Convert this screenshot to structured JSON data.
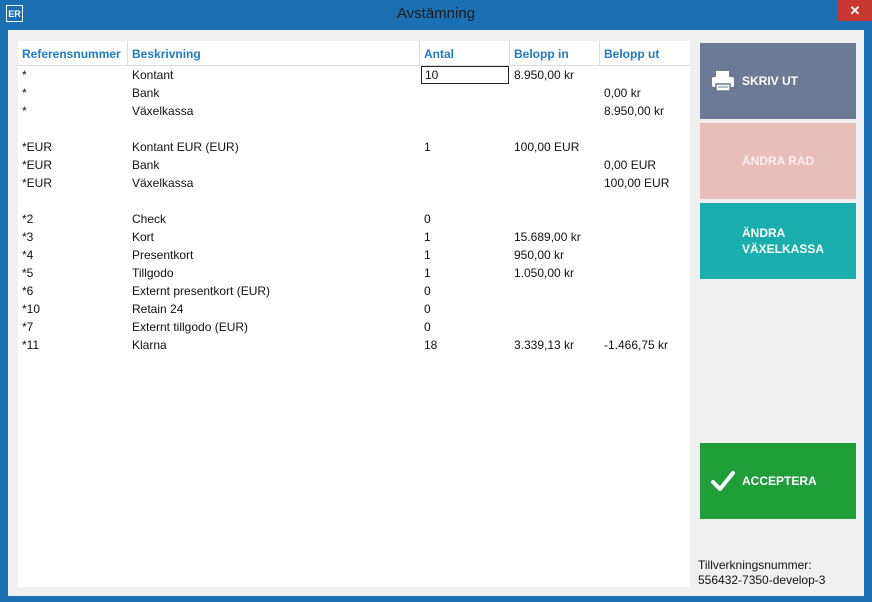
{
  "window": {
    "app_icon": "ER",
    "title": "Avstämning",
    "close_glyph": "✕"
  },
  "table": {
    "headers": [
      "Referensnummer",
      "Beskrivning",
      "Antal",
      "Belopp in",
      "Belopp ut"
    ],
    "rows": [
      {
        "ref": "*",
        "desc": "Kontant",
        "antal": "10",
        "in": "8.950,00 kr",
        "out": ""
      },
      {
        "ref": "*",
        "desc": "Bank",
        "antal": "",
        "in": "",
        "out": "0,00 kr"
      },
      {
        "ref": "*",
        "desc": "Växelkassa",
        "antal": "",
        "in": "",
        "out": "8.950,00 kr"
      },
      {
        "ref": "*EUR",
        "desc": "Kontant EUR (EUR)",
        "antal": "1",
        "in": "100,00 EUR",
        "out": ""
      },
      {
        "ref": "*EUR",
        "desc": "Bank",
        "antal": "",
        "in": "",
        "out": "0,00 EUR"
      },
      {
        "ref": "*EUR",
        "desc": "Växelkassa",
        "antal": "",
        "in": "",
        "out": "100,00 EUR"
      },
      {
        "ref": "*2",
        "desc": "Check",
        "antal": "0",
        "in": "",
        "out": ""
      },
      {
        "ref": "*3",
        "desc": "Kort",
        "antal": "1",
        "in": "15.689,00 kr",
        "out": ""
      },
      {
        "ref": "*4",
        "desc": "Presentkort",
        "antal": "1",
        "in": "950,00 kr",
        "out": ""
      },
      {
        "ref": "*5",
        "desc": "Tillgodo",
        "antal": "1",
        "in": "1.050,00 kr",
        "out": ""
      },
      {
        "ref": "*6",
        "desc": "Externt presentkort (EUR)",
        "antal": "0",
        "in": "",
        "out": ""
      },
      {
        "ref": "*10",
        "desc": "Retain 24",
        "antal": "0",
        "in": "",
        "out": ""
      },
      {
        "ref": "*7",
        "desc": "Externt tillgodo (EUR)",
        "antal": "0",
        "in": "",
        "out": ""
      },
      {
        "ref": "*11",
        "desc": "Klarna",
        "antal": "18",
        "in": "3.339,13 kr",
        "out": "-1.466,75 kr"
      }
    ]
  },
  "actions": {
    "print": {
      "label": "SKRIV UT",
      "icon": "printer-icon",
      "color": "#6b7b96"
    },
    "edit_row": {
      "label": "ÄNDRA RAD",
      "color": "#e8beb8"
    },
    "edit_float": {
      "label": "ÄNDRA VÄXELKASSA",
      "color": "#1aaeae"
    },
    "accept": {
      "label": "ACCEPTERA",
      "icon": "checkmark-icon",
      "color": "#1f9e3a"
    }
  },
  "serial": {
    "label": "Tillverkningsnummer:",
    "value": "556432-7350-develop-3"
  }
}
